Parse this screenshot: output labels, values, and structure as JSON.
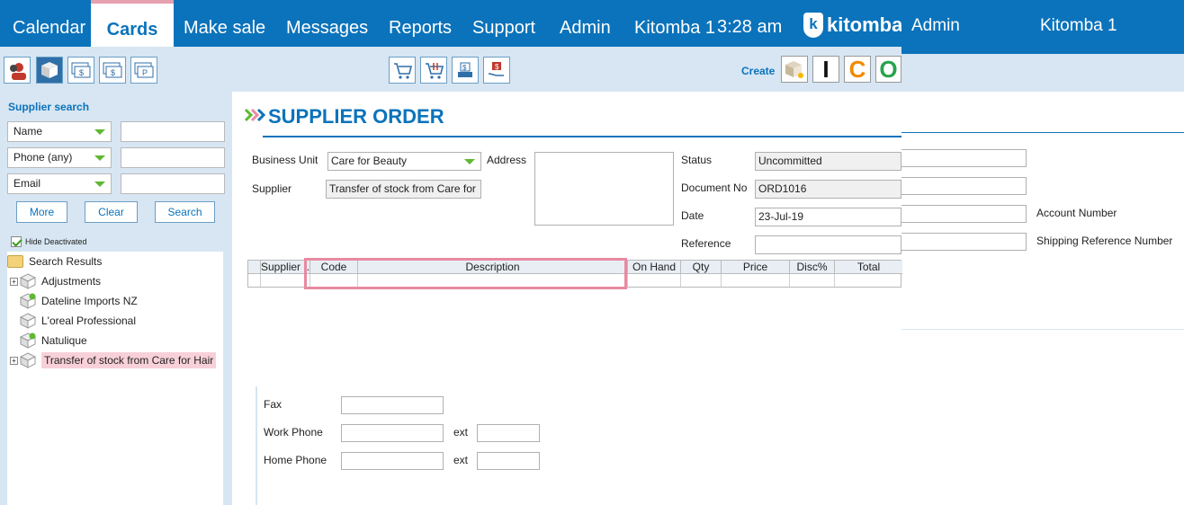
{
  "nav": {
    "items": [
      "Calendar",
      "Cards",
      "Make sale",
      "Messages",
      "Reports",
      "Support",
      "Admin",
      "Kitomba 1"
    ],
    "active": "Cards",
    "time": "3:28 am",
    "logo_text": "kitomba",
    "logo_badge": "k",
    "right_items": [
      "Admin",
      "Kitomba 1"
    ]
  },
  "toolbar": {
    "create_label": "Create",
    "create_letters": [
      "I",
      "C",
      "O"
    ]
  },
  "colors": {
    "brand": "#0b73bb",
    "panel": "#d7e6f2",
    "highlight": "#f8d0da",
    "accent_green": "#5fb832"
  },
  "left": {
    "title": "Supplier search",
    "filters": [
      {
        "label": "Name",
        "value": ""
      },
      {
        "label": "Phone (any)",
        "value": ""
      },
      {
        "label": "Email",
        "value": ""
      }
    ],
    "buttons": [
      "More",
      "Clear",
      "Search"
    ],
    "hide_deactivated": "Hide Deactivated",
    "tree_root": "Search Results",
    "tree_items": [
      "Adjustments",
      "Dateline Imports NZ",
      "L'oreal Professional",
      "Natulique",
      "Transfer of stock from Care for Hair"
    ]
  },
  "main": {
    "title": "SUPPLIER ORDER",
    "business_unit_label": "Business Unit",
    "business_unit_value": "Care for Beauty",
    "supplier_label": "Supplier",
    "supplier_value": "Transfer of stock from Care for",
    "address_label": "Address",
    "status_label": "Status",
    "status_value": "Uncommitted",
    "docno_label": "Document No",
    "docno_value": "ORD1016",
    "date_label": "Date",
    "date_value": "23-Jul-19",
    "reference_label": "Reference",
    "reference_value": "",
    "columns": [
      "Supplier ...",
      "Code",
      "Description",
      "On Hand",
      "Qty",
      "Price",
      "Disc%",
      "Total"
    ],
    "account_number_label": "Account Number",
    "shipping_ref_label": "Shipping Reference Number",
    "fax_label": "Fax",
    "work_phone_label": "Work Phone",
    "home_phone_label": "Home Phone",
    "ext_label": "ext"
  }
}
